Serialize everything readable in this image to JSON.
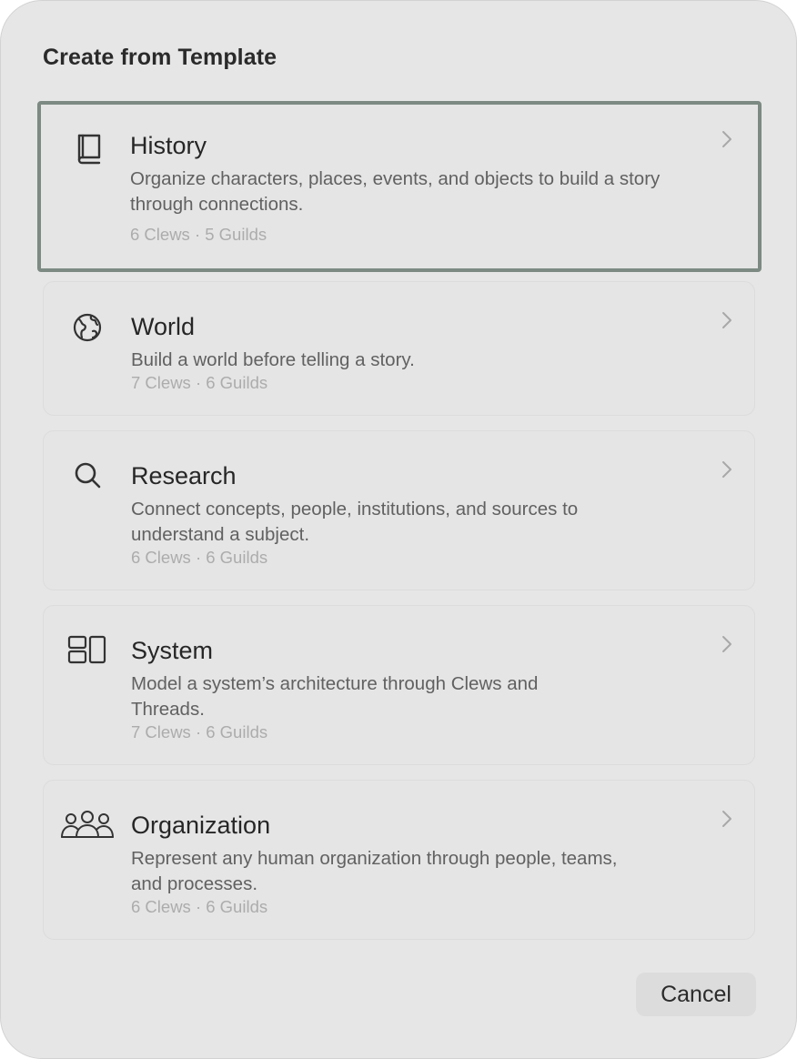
{
  "dialog": {
    "title": "Create from Template",
    "cancel_label": "Cancel"
  },
  "templates": [
    {
      "name": "History",
      "description": "Organize characters, places, events, and objects to build a story through connections.",
      "meta": "6 Clews · 5 Guilds",
      "icon": "book-icon",
      "selected": true
    },
    {
      "name": "World",
      "description": "Build a world before telling a story.",
      "meta": "7 Clews · 6 Guilds",
      "icon": "globe-icon"
    },
    {
      "name": "Research",
      "description": "Connect concepts, people, institutions, and sources to understand a subject.",
      "meta": "6 Clews · 6 Guilds",
      "icon": "search-icon"
    },
    {
      "name": "System",
      "description": "Model a system’s architecture through Clews and Threads.",
      "meta": "7 Clews · 6 Guilds",
      "icon": "system-blocks-icon"
    },
    {
      "name": "Organization",
      "description": "Represent any human organization through people, teams, and processes.",
      "meta": "6 Clews · 6 Guilds",
      "icon": "people-group-icon"
    }
  ],
  "colors": {
    "background": "#e6e6e6",
    "selection_border": "#7c8a83",
    "meta_text": "#acacac"
  }
}
